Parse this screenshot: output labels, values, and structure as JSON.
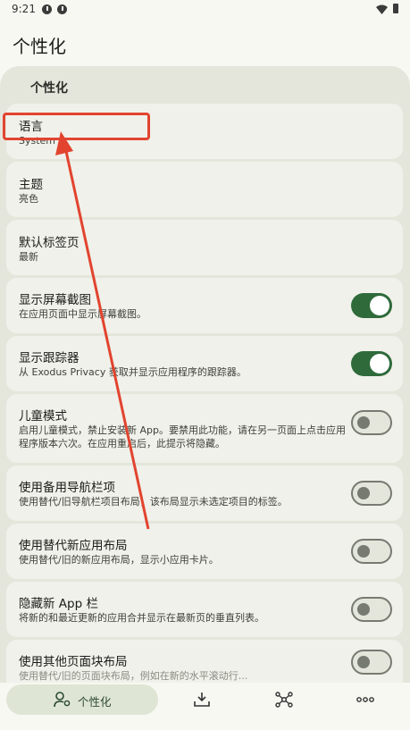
{
  "status": {
    "time": "9:21"
  },
  "page": {
    "title": "个性化"
  },
  "section": {
    "title": "个性化"
  },
  "items": [
    {
      "title": "语言",
      "subtitle": "System"
    },
    {
      "title": "主题",
      "subtitle": "亮色"
    },
    {
      "title": "默认标签页",
      "subtitle": "最新"
    },
    {
      "title": "显示屏幕截图",
      "subtitle": "在应用页面中显示屏幕截图。",
      "toggle": "on"
    },
    {
      "title": "显示跟踪器",
      "subtitle": "从 Exodus Privacy 获取并显示应用程序的跟踪器。",
      "toggle": "on"
    },
    {
      "title": "儿童模式",
      "subtitle": "启用儿童模式，禁止安装新 App。要禁用此功能，请在另一页面上点击应用程序版本六次。在应用重启后，此提示将隐藏。",
      "toggle": "off"
    },
    {
      "title": "使用备用导航栏项",
      "subtitle": "使用替代/旧导航栏项目布局，该布局显示未选定项目的标签。",
      "toggle": "off"
    },
    {
      "title": "使用替代新应用布局",
      "subtitle": "使用替代/旧的新应用布局，显示小应用卡片。",
      "toggle": "off"
    },
    {
      "title": "隐藏新 App 栏",
      "subtitle": "将新的和最近更新的应用合并显示在最新页的垂直列表。",
      "toggle": "off"
    },
    {
      "title": "使用其他页面块布局",
      "subtitle": "使用替代/旧的页面块布局，例如在新的水平滚动行...",
      "toggle": "off"
    }
  ],
  "nav": {
    "active_label": "个性化",
    "icons": [
      "person-settings-icon",
      "download-icon",
      "hub-icon",
      "more-icon"
    ]
  },
  "colors": {
    "accent": "#2f6a3b",
    "annotation": "#e2442f"
  }
}
